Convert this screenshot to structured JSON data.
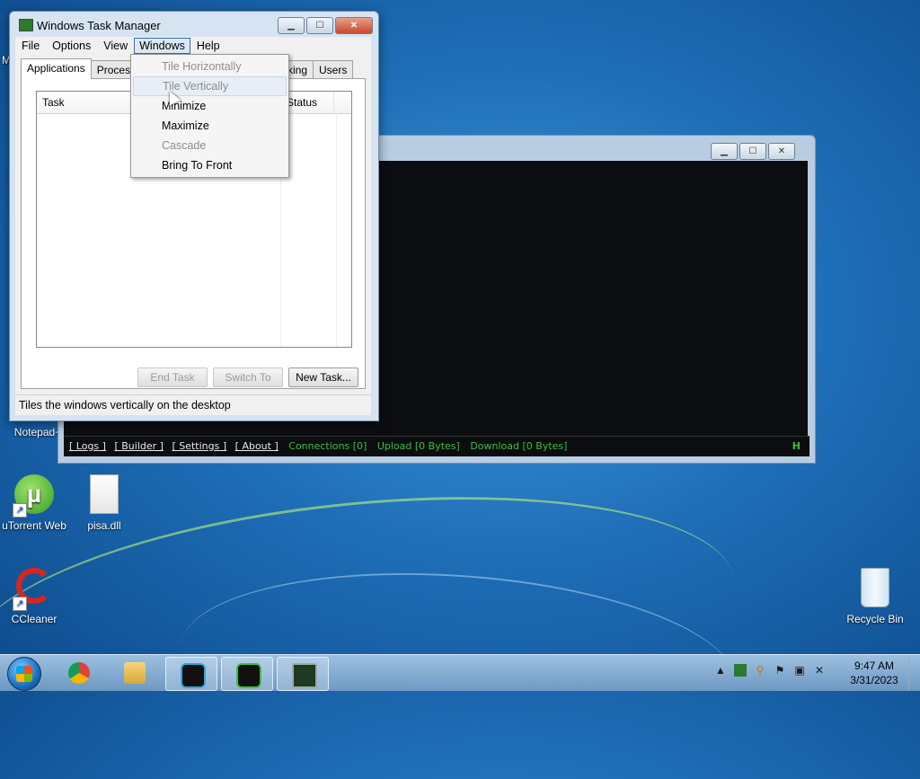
{
  "task_manager": {
    "title": "Windows Task Manager",
    "menu": [
      "File",
      "Options",
      "View",
      "Windows",
      "Help"
    ],
    "tabs": [
      "Applications",
      "Processes",
      "king",
      "Users"
    ],
    "columns": {
      "task": "Task",
      "status": "Status"
    },
    "buttons": {
      "end_task": "End Task",
      "switch_to": "Switch To",
      "new_task": "New Task..."
    },
    "status_text": "Tiles the windows vertically on the desktop"
  },
  "windows_menu": {
    "items": [
      {
        "label": "Tile Horizontally",
        "enabled": false
      },
      {
        "label": "Tile Vertically",
        "enabled": false
      },
      {
        "label": "Minimize",
        "enabled": true
      },
      {
        "label": "Maximize",
        "enabled": true
      },
      {
        "label": "Cascade",
        "enabled": false
      },
      {
        "label": "Bring To Front",
        "enabled": true
      }
    ]
  },
  "rat_window": {
    "links": [
      "[ Logs ]",
      "[ Builder ]",
      "[ Settings ]",
      "[ About ]"
    ],
    "status": {
      "connections": "Connections [0]",
      "upload": "Upload [0 Bytes]",
      "download": "Download [0 Bytes]"
    },
    "hotkey": "H"
  },
  "desktop": {
    "icons": [
      {
        "label": "Notepad+",
        "icon": "notepad-icon"
      },
      {
        "label": "uTorrent Web",
        "icon": "utorrent-icon"
      },
      {
        "label": "pisa.dll",
        "icon": "file-icon"
      },
      {
        "label": "CCleaner",
        "icon": "ccleaner-icon"
      },
      {
        "label": "Recycle Bin",
        "icon": "recycle-bin-icon"
      }
    ],
    "edge_letter": "M"
  },
  "taskbar": {
    "apps": [
      "chrome-icon",
      "explorer-icon",
      "nj-icon",
      "nj-icon",
      "task-manager-icon"
    ],
    "time": "9:47 AM",
    "date": "3/31/2023"
  },
  "colors": {
    "accent_green": "#3fbf3f",
    "disabled_text": "#8d8d8d"
  }
}
